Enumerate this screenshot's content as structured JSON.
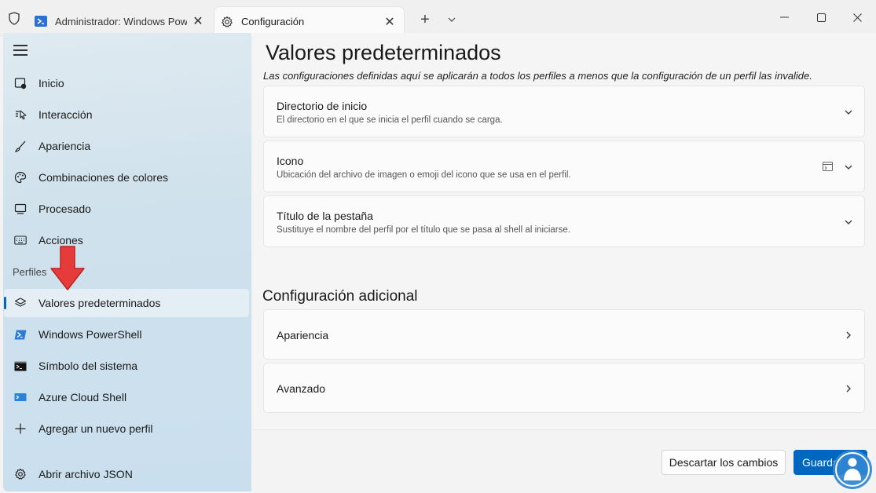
{
  "titlebar": {
    "tabs": [
      {
        "label": "Administrador: Windows PowerShell",
        "icon": "powershell-icon",
        "active": false
      },
      {
        "label": "Configuración",
        "icon": "gear-icon",
        "active": true
      }
    ],
    "close_symbol": "✕",
    "new_tab_symbol": "+"
  },
  "sidebar": {
    "items": [
      {
        "label": "Inicio",
        "icon": "home-icon"
      },
      {
        "label": "Interacción",
        "icon": "pointer-icon"
      },
      {
        "label": "Apariencia",
        "icon": "brush-icon"
      },
      {
        "label": "Combinaciones de colores",
        "icon": "palette-icon"
      },
      {
        "label": "Procesado",
        "icon": "monitor-icon"
      },
      {
        "label": "Acciones",
        "icon": "keyboard-icon"
      }
    ],
    "section_label": "Perfiles",
    "profiles": [
      {
        "label": "Valores predeterminados",
        "icon": "layers-icon",
        "selected": true
      },
      {
        "label": "Windows PowerShell",
        "icon": "powershell-icon"
      },
      {
        "label": "Símbolo del sistema",
        "icon": "cmd-icon"
      },
      {
        "label": "Azure Cloud Shell",
        "icon": "azure-icon"
      },
      {
        "label": "Agregar un nuevo perfil",
        "icon": "plus-icon"
      }
    ],
    "json_item": {
      "label": "Abrir archivo JSON",
      "icon": "gear-icon"
    }
  },
  "main": {
    "title": "Valores predeterminados",
    "description": "Las configuraciones definidas aquí se aplicarán a todos los perfiles a menos que la configuración de un perfil las invalide.",
    "cards": [
      {
        "title": "Directorio de inicio",
        "desc": "El directorio en el que se inicia el perfil cuando se carga."
      },
      {
        "title": "Icono",
        "desc": "Ubicación del archivo de imagen o emoji del icono que se usa en el perfil."
      },
      {
        "title": "Título de la pestaña",
        "desc": "Sustituye el nombre del perfil por el título que se pasa al shell al iniciarse."
      }
    ],
    "additional_title": "Configuración adicional",
    "links": [
      {
        "label": "Apariencia"
      },
      {
        "label": "Avanzado"
      }
    ],
    "footer": {
      "discard_label": "Descartar los cambios",
      "save_label": "Guardar"
    }
  },
  "colors": {
    "accent": "#0067c0",
    "annotation_arrow": "#e63b3b",
    "sidebar_bg": "#cfe1ec"
  }
}
